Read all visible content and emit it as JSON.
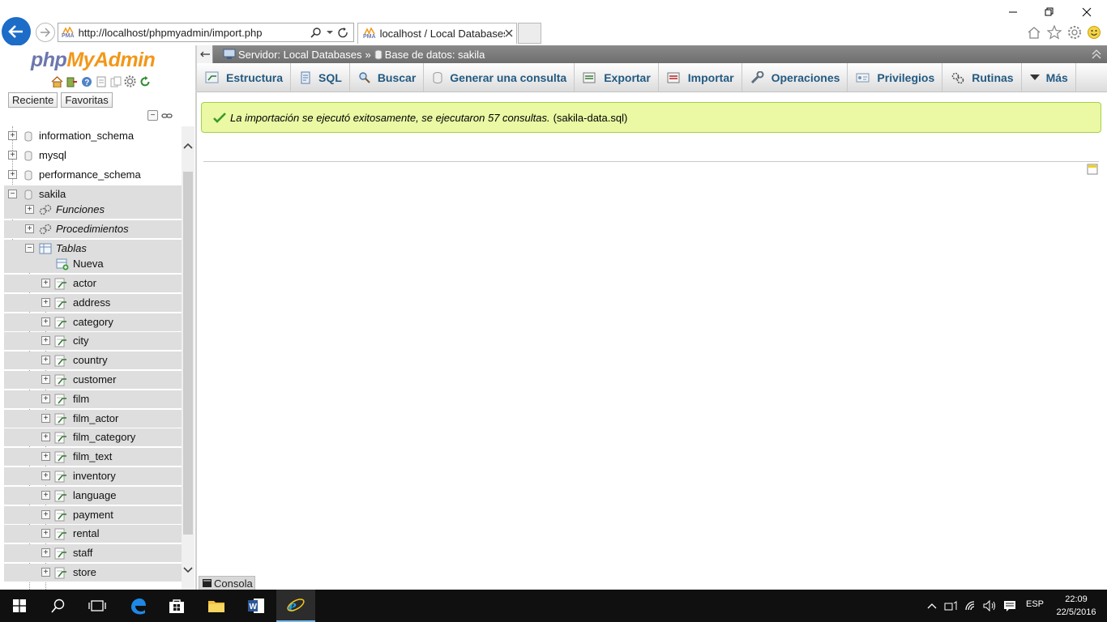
{
  "browser": {
    "url": "http://localhost/phpmyadmin/import.php",
    "tab_title": "localhost / Local Databases ...",
    "favicon_label": "PMA"
  },
  "sidebar": {
    "logo_php": "php",
    "logo_myadmin": "MyAdmin",
    "recent_label": "Reciente",
    "favorites_label": "Favoritas",
    "databases": [
      {
        "name": "information_schema"
      },
      {
        "name": "mysql"
      },
      {
        "name": "performance_schema"
      },
      {
        "name": "sakila"
      }
    ],
    "sakila_children": {
      "functions": "Funciones",
      "procedures": "Procedimientos",
      "tables": "Tablas",
      "new_table": "Nueva"
    },
    "tables": [
      "actor",
      "address",
      "category",
      "city",
      "country",
      "customer",
      "film",
      "film_actor",
      "film_category",
      "film_text",
      "inventory",
      "language",
      "payment",
      "rental",
      "staff",
      "store"
    ]
  },
  "breadcrumb": {
    "server": "Servidor: Local Databases",
    "separator": "»",
    "database": "Base de datos: sakila"
  },
  "menu": {
    "tabs": [
      "Estructura",
      "SQL",
      "Buscar",
      "Generar una consulta",
      "Exportar",
      "Importar",
      "Operaciones",
      "Privilegios",
      "Rutinas",
      "Más"
    ]
  },
  "message": {
    "text": "La importación se ejecutó exitosamente, se ejecutaron 57 consultas.",
    "file": "(sakila-data.sql)"
  },
  "console": {
    "label": "Consola"
  },
  "taskbar": {
    "language": "ESP",
    "time": "22:09",
    "date": "22/5/2016"
  },
  "colors": {
    "pma_link_blue": "#235a81",
    "success_bg": "#ebf8a4",
    "success_border": "#a2d246",
    "taskbar_bg": "#101010"
  }
}
